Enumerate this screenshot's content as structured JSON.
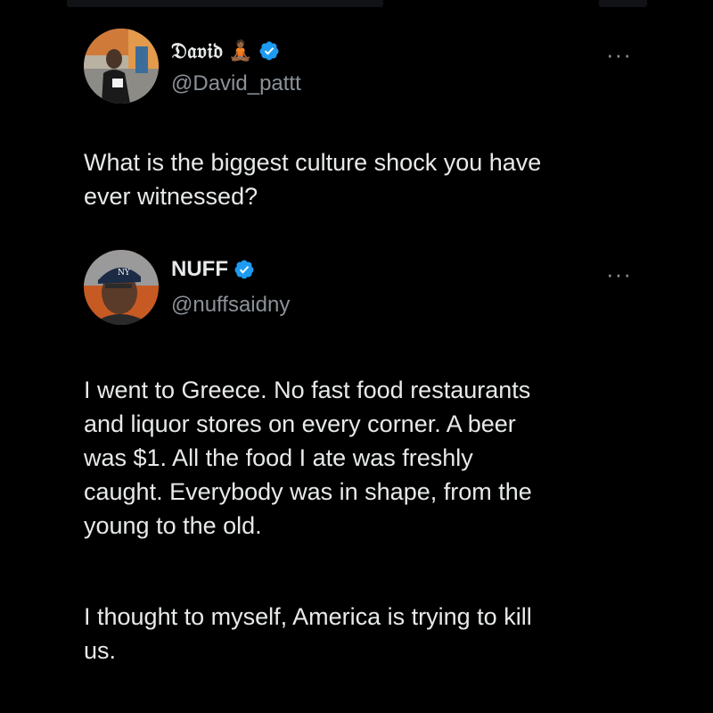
{
  "tweet": {
    "author": {
      "display_name": "𝔇𝔞𝔳𝔦𝔡",
      "emoji": "🧘🏾",
      "handle": "@David_pattt",
      "verified": true,
      "avatar_icon": "avatar-photo"
    },
    "more_label": "···",
    "text": "What is the biggest culture shock you have\never witnessed?"
  },
  "reply": {
    "author": {
      "display_name": "NUFF",
      "handle": "@nuffsaidny",
      "verified": true,
      "avatar_icon": "avatar-photo",
      "cap_logo": "NY"
    },
    "more_label": "···",
    "paragraph1": "I went to Greece. No fast food restaurants\nand liquor stores on every corner. A beer\nwas $1. All the food I ate was freshly\ncaught. Everybody was in shape, from the\nyoung to the old.",
    "paragraph2": "I thought to myself, America is trying to kill\nus."
  },
  "colors": {
    "background": "#000000",
    "text": "#e7e9ea",
    "secondary": "#8b9198",
    "verified_blue": "#1d9bf0"
  }
}
